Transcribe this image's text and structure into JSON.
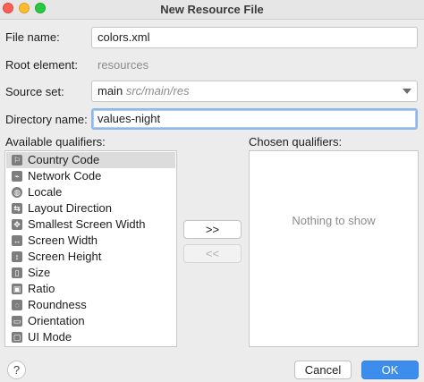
{
  "window": {
    "title": "New Resource File"
  },
  "form": {
    "file_name_label": "File name:",
    "file_name_value": "colors.xml",
    "root_element_label": "Root element:",
    "root_element_value": "resources",
    "source_set_label": "Source set:",
    "source_set_value": "main",
    "source_set_path": "src/main/res",
    "directory_name_label": "Directory name:",
    "directory_name_value": "values-night"
  },
  "qualifiers": {
    "available_label": "Available qualifiers:",
    "chosen_label": "Chosen qualifiers:",
    "chosen_empty": "Nothing to show",
    "items": [
      {
        "label": "Country Code",
        "icon": "country-code-icon",
        "glyph": "⚐"
      },
      {
        "label": "Network Code",
        "icon": "network-code-icon",
        "glyph": "⌁"
      },
      {
        "label": "Locale",
        "icon": "globe-icon",
        "glyph": "◍"
      },
      {
        "label": "Layout Direction",
        "icon": "layout-direction-icon",
        "glyph": "⇆"
      },
      {
        "label": "Smallest Screen Width",
        "icon": "smallest-width-icon",
        "glyph": "✥"
      },
      {
        "label": "Screen Width",
        "icon": "screen-width-icon",
        "glyph": "↔"
      },
      {
        "label": "Screen Height",
        "icon": "screen-height-icon",
        "glyph": "↕"
      },
      {
        "label": "Size",
        "icon": "size-icon",
        "glyph": "▯"
      },
      {
        "label": "Ratio",
        "icon": "ratio-icon",
        "glyph": "▣"
      },
      {
        "label": "Roundness",
        "icon": "roundness-icon",
        "glyph": "◌"
      },
      {
        "label": "Orientation",
        "icon": "orientation-icon",
        "glyph": "▭"
      },
      {
        "label": "UI Mode",
        "icon": "ui-mode-icon",
        "glyph": "▢"
      }
    ]
  },
  "buttons": {
    "add": ">>",
    "remove": "<<",
    "help": "?",
    "cancel": "Cancel",
    "ok": "OK"
  }
}
